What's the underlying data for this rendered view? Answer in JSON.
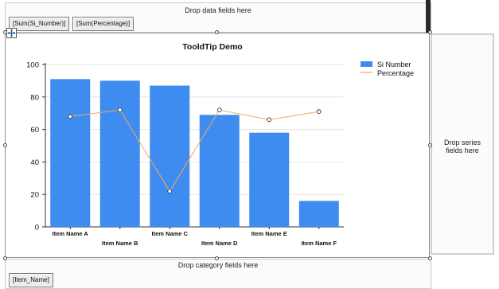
{
  "data_zone": {
    "hint": "Drop data fields here",
    "fields": [
      "[Sum(Si_Number)]",
      "[Sum(Percentage)]"
    ]
  },
  "series_zone": {
    "hint": "Drop series fields here"
  },
  "category_zone": {
    "hint": "Drop category fields here",
    "fields": [
      "[Item_Name]"
    ]
  },
  "chart_data": {
    "type": "bar",
    "title": "ToolTip Demo",
    "categories": [
      "Item Name A",
      "Item Name B",
      "Item Name C",
      "Item Name D",
      "Item Name E",
      "Item Name F"
    ],
    "ylim": [
      0,
      100
    ],
    "yticks": [
      0,
      20,
      40,
      60,
      80,
      100
    ],
    "grid": true,
    "legend_position": "top-right",
    "series": [
      {
        "name": "Si Number",
        "kind": "bar",
        "color": "#3f8cf0",
        "values": [
          91,
          90,
          87,
          69,
          58,
          16
        ]
      },
      {
        "name": "Percentage",
        "kind": "line",
        "color": "#f5a85a",
        "values": [
          68,
          72,
          22,
          72,
          66,
          71
        ]
      }
    ]
  },
  "chart_title_display": "TooldTip Demo"
}
